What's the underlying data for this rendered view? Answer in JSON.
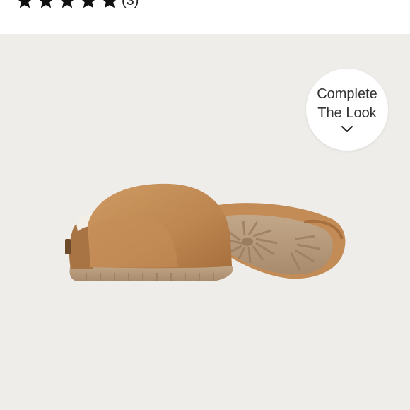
{
  "rating": {
    "stars": 5,
    "star_fill": 5,
    "review_count": "(3)"
  },
  "complete_the_look": {
    "line1": "Complete",
    "line2": "The Look",
    "icon": "chevron-down-icon"
  },
  "colors": {
    "backdrop": "#efedea",
    "suede": "#c08a54",
    "sole": "#b79a7c"
  }
}
